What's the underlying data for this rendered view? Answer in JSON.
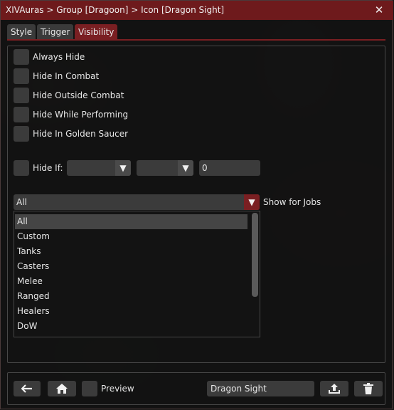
{
  "window": {
    "title": "XIVAuras > Group [Dragoon] > Icon [Dragon Sight]",
    "close_glyph": "✕"
  },
  "tabs": [
    {
      "label": "Style",
      "active": false
    },
    {
      "label": "Trigger",
      "active": false
    },
    {
      "label": "Visibility",
      "active": true
    }
  ],
  "visibility": {
    "options": [
      {
        "label": "Always Hide",
        "checked": false
      },
      {
        "label": "Hide In Combat",
        "checked": false
      },
      {
        "label": "Hide Outside Combat",
        "checked": false
      },
      {
        "label": "Hide While Performing",
        "checked": false
      },
      {
        "label": "Hide In Golden Saucer",
        "checked": false
      }
    ],
    "hide_if": {
      "label": "Hide If:",
      "condition_value": "",
      "operator_value": "",
      "value": "0",
      "arrow_glyph": "▼"
    },
    "jobs": {
      "selected": "All",
      "label": "Show for Jobs",
      "arrow_glyph": "▼",
      "options": [
        "All",
        "Custom",
        "Tanks",
        "Casters",
        "Melee",
        "Ranged",
        "Healers",
        "DoW"
      ],
      "highlighted_index": 0
    }
  },
  "footer": {
    "back_icon": "arrow-left-icon",
    "home_icon": "home-icon",
    "preview_label": "Preview",
    "preview_checked": false,
    "name_value": "Dragon Sight",
    "export_icon": "upload-icon",
    "delete_icon": "trash-icon"
  },
  "colors": {
    "title_bar": "#6e1a1c",
    "accent": "#7a1f22",
    "control_bg": "#3b3b3b"
  }
}
